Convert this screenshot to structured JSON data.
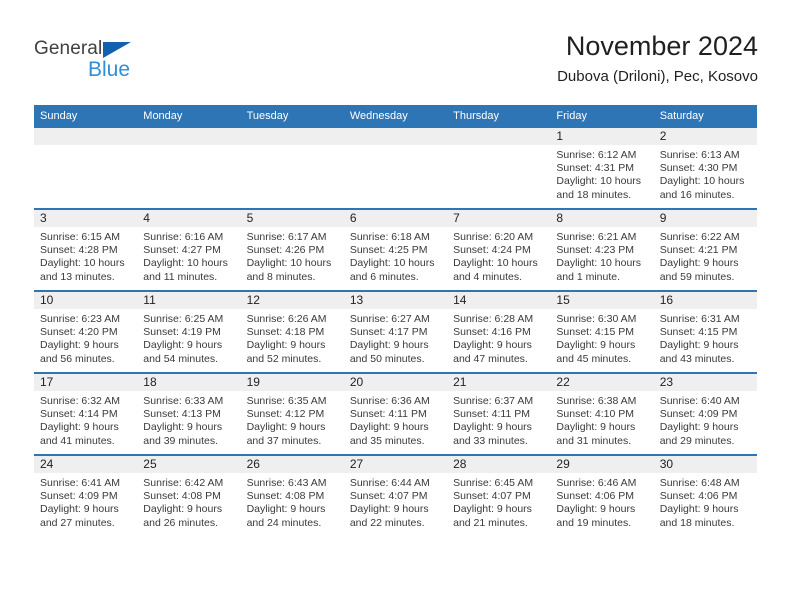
{
  "brand": {
    "name_part1": "General",
    "name_part2": "Blue",
    "triangle_color": "#1161ad",
    "blue_color": "#2e8fd6"
  },
  "header": {
    "title": "November 2024",
    "subtitle": "Dubova (Driloni), Pec, Kosovo"
  },
  "theme": {
    "header_blue": "#2e75b6",
    "daynum_band": "#efefef",
    "text": "#231f20"
  },
  "weekdays": [
    "Sunday",
    "Monday",
    "Tuesday",
    "Wednesday",
    "Thursday",
    "Friday",
    "Saturday"
  ],
  "weeks": [
    [
      {
        "day": "",
        "empty": true
      },
      {
        "day": "",
        "empty": true
      },
      {
        "day": "",
        "empty": true
      },
      {
        "day": "",
        "empty": true
      },
      {
        "day": "",
        "empty": true
      },
      {
        "day": "1",
        "sunrise": "Sunrise: 6:12 AM",
        "sunset": "Sunset: 4:31 PM",
        "daylight": "Daylight: 10 hours and 18 minutes."
      },
      {
        "day": "2",
        "sunrise": "Sunrise: 6:13 AM",
        "sunset": "Sunset: 4:30 PM",
        "daylight": "Daylight: 10 hours and 16 minutes."
      }
    ],
    [
      {
        "day": "3",
        "sunrise": "Sunrise: 6:15 AM",
        "sunset": "Sunset: 4:28 PM",
        "daylight": "Daylight: 10 hours and 13 minutes."
      },
      {
        "day": "4",
        "sunrise": "Sunrise: 6:16 AM",
        "sunset": "Sunset: 4:27 PM",
        "daylight": "Daylight: 10 hours and 11 minutes."
      },
      {
        "day": "5",
        "sunrise": "Sunrise: 6:17 AM",
        "sunset": "Sunset: 4:26 PM",
        "daylight": "Daylight: 10 hours and 8 minutes."
      },
      {
        "day": "6",
        "sunrise": "Sunrise: 6:18 AM",
        "sunset": "Sunset: 4:25 PM",
        "daylight": "Daylight: 10 hours and 6 minutes."
      },
      {
        "day": "7",
        "sunrise": "Sunrise: 6:20 AM",
        "sunset": "Sunset: 4:24 PM",
        "daylight": "Daylight: 10 hours and 4 minutes."
      },
      {
        "day": "8",
        "sunrise": "Sunrise: 6:21 AM",
        "sunset": "Sunset: 4:23 PM",
        "daylight": "Daylight: 10 hours and 1 minute."
      },
      {
        "day": "9",
        "sunrise": "Sunrise: 6:22 AM",
        "sunset": "Sunset: 4:21 PM",
        "daylight": "Daylight: 9 hours and 59 minutes."
      }
    ],
    [
      {
        "day": "10",
        "sunrise": "Sunrise: 6:23 AM",
        "sunset": "Sunset: 4:20 PM",
        "daylight": "Daylight: 9 hours and 56 minutes."
      },
      {
        "day": "11",
        "sunrise": "Sunrise: 6:25 AM",
        "sunset": "Sunset: 4:19 PM",
        "daylight": "Daylight: 9 hours and 54 minutes."
      },
      {
        "day": "12",
        "sunrise": "Sunrise: 6:26 AM",
        "sunset": "Sunset: 4:18 PM",
        "daylight": "Daylight: 9 hours and 52 minutes."
      },
      {
        "day": "13",
        "sunrise": "Sunrise: 6:27 AM",
        "sunset": "Sunset: 4:17 PM",
        "daylight": "Daylight: 9 hours and 50 minutes."
      },
      {
        "day": "14",
        "sunrise": "Sunrise: 6:28 AM",
        "sunset": "Sunset: 4:16 PM",
        "daylight": "Daylight: 9 hours and 47 minutes."
      },
      {
        "day": "15",
        "sunrise": "Sunrise: 6:30 AM",
        "sunset": "Sunset: 4:15 PM",
        "daylight": "Daylight: 9 hours and 45 minutes."
      },
      {
        "day": "16",
        "sunrise": "Sunrise: 6:31 AM",
        "sunset": "Sunset: 4:15 PM",
        "daylight": "Daylight: 9 hours and 43 minutes."
      }
    ],
    [
      {
        "day": "17",
        "sunrise": "Sunrise: 6:32 AM",
        "sunset": "Sunset: 4:14 PM",
        "daylight": "Daylight: 9 hours and 41 minutes."
      },
      {
        "day": "18",
        "sunrise": "Sunrise: 6:33 AM",
        "sunset": "Sunset: 4:13 PM",
        "daylight": "Daylight: 9 hours and 39 minutes."
      },
      {
        "day": "19",
        "sunrise": "Sunrise: 6:35 AM",
        "sunset": "Sunset: 4:12 PM",
        "daylight": "Daylight: 9 hours and 37 minutes."
      },
      {
        "day": "20",
        "sunrise": "Sunrise: 6:36 AM",
        "sunset": "Sunset: 4:11 PM",
        "daylight": "Daylight: 9 hours and 35 minutes."
      },
      {
        "day": "21",
        "sunrise": "Sunrise: 6:37 AM",
        "sunset": "Sunset: 4:11 PM",
        "daylight": "Daylight: 9 hours and 33 minutes."
      },
      {
        "day": "22",
        "sunrise": "Sunrise: 6:38 AM",
        "sunset": "Sunset: 4:10 PM",
        "daylight": "Daylight: 9 hours and 31 minutes."
      },
      {
        "day": "23",
        "sunrise": "Sunrise: 6:40 AM",
        "sunset": "Sunset: 4:09 PM",
        "daylight": "Daylight: 9 hours and 29 minutes."
      }
    ],
    [
      {
        "day": "24",
        "sunrise": "Sunrise: 6:41 AM",
        "sunset": "Sunset: 4:09 PM",
        "daylight": "Daylight: 9 hours and 27 minutes."
      },
      {
        "day": "25",
        "sunrise": "Sunrise: 6:42 AM",
        "sunset": "Sunset: 4:08 PM",
        "daylight": "Daylight: 9 hours and 26 minutes."
      },
      {
        "day": "26",
        "sunrise": "Sunrise: 6:43 AM",
        "sunset": "Sunset: 4:08 PM",
        "daylight": "Daylight: 9 hours and 24 minutes."
      },
      {
        "day": "27",
        "sunrise": "Sunrise: 6:44 AM",
        "sunset": "Sunset: 4:07 PM",
        "daylight": "Daylight: 9 hours and 22 minutes."
      },
      {
        "day": "28",
        "sunrise": "Sunrise: 6:45 AM",
        "sunset": "Sunset: 4:07 PM",
        "daylight": "Daylight: 9 hours and 21 minutes."
      },
      {
        "day": "29",
        "sunrise": "Sunrise: 6:46 AM",
        "sunset": "Sunset: 4:06 PM",
        "daylight": "Daylight: 9 hours and 19 minutes."
      },
      {
        "day": "30",
        "sunrise": "Sunrise: 6:48 AM",
        "sunset": "Sunset: 4:06 PM",
        "daylight": "Daylight: 9 hours and 18 minutes."
      }
    ]
  ]
}
